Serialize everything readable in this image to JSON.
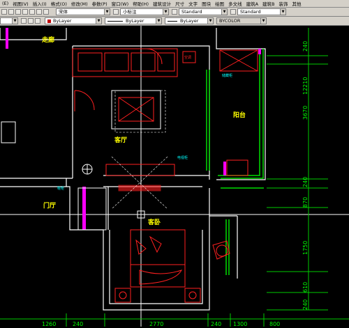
{
  "menu": [
    "(E)",
    "视图(V)",
    "插入(I)",
    "格式(O)",
    "修改(M)",
    "参数(P)",
    "窗口(W)",
    "帮助(H)",
    "建筑设计",
    "尺寸",
    "文字",
    "图块",
    "绘图",
    "多文线",
    "建筑A",
    "建筑B",
    "装饰",
    "其他"
  ],
  "toolbar1": {
    "font_combo": "宋体",
    "textstyle_combo": "小标注",
    "dimstyle_combo": "Standard",
    "tablestyle_combo": "Standard"
  },
  "toolbar2": {
    "layer_combo": "",
    "color_combo": "ByLayer",
    "linetype_combo": "ByLayer",
    "lineweight_combo": "ByLayer",
    "plotstyle_combo": "BYCOLOR"
  },
  "drawing": {
    "room_labels": {
      "corridor": "走廊",
      "living_room": "客厅",
      "balcony": "阳台",
      "entrance": "门厅",
      "guest_bedroom": "客卧"
    },
    "annotations": {
      "ac": "空调",
      "tv_cabinet": "电视柜",
      "shoe_cabinet": "鞋柜",
      "balcony_cabinet": "储藏柜"
    },
    "dims_right": [
      "240",
      "12210",
      "3670",
      "240",
      "870",
      "1750",
      "610",
      "240"
    ],
    "dims_bottom": [
      "1260",
      "240",
      "2770",
      "240",
      "1300",
      "800"
    ],
    "colors": {
      "wall": "#ffffff",
      "furniture": "#ff2020",
      "dimension": "#00ff00",
      "label": "#ffff00",
      "annotation": "#00ffff",
      "hatch": "#ff00ff",
      "grid": "#ffffff"
    }
  }
}
